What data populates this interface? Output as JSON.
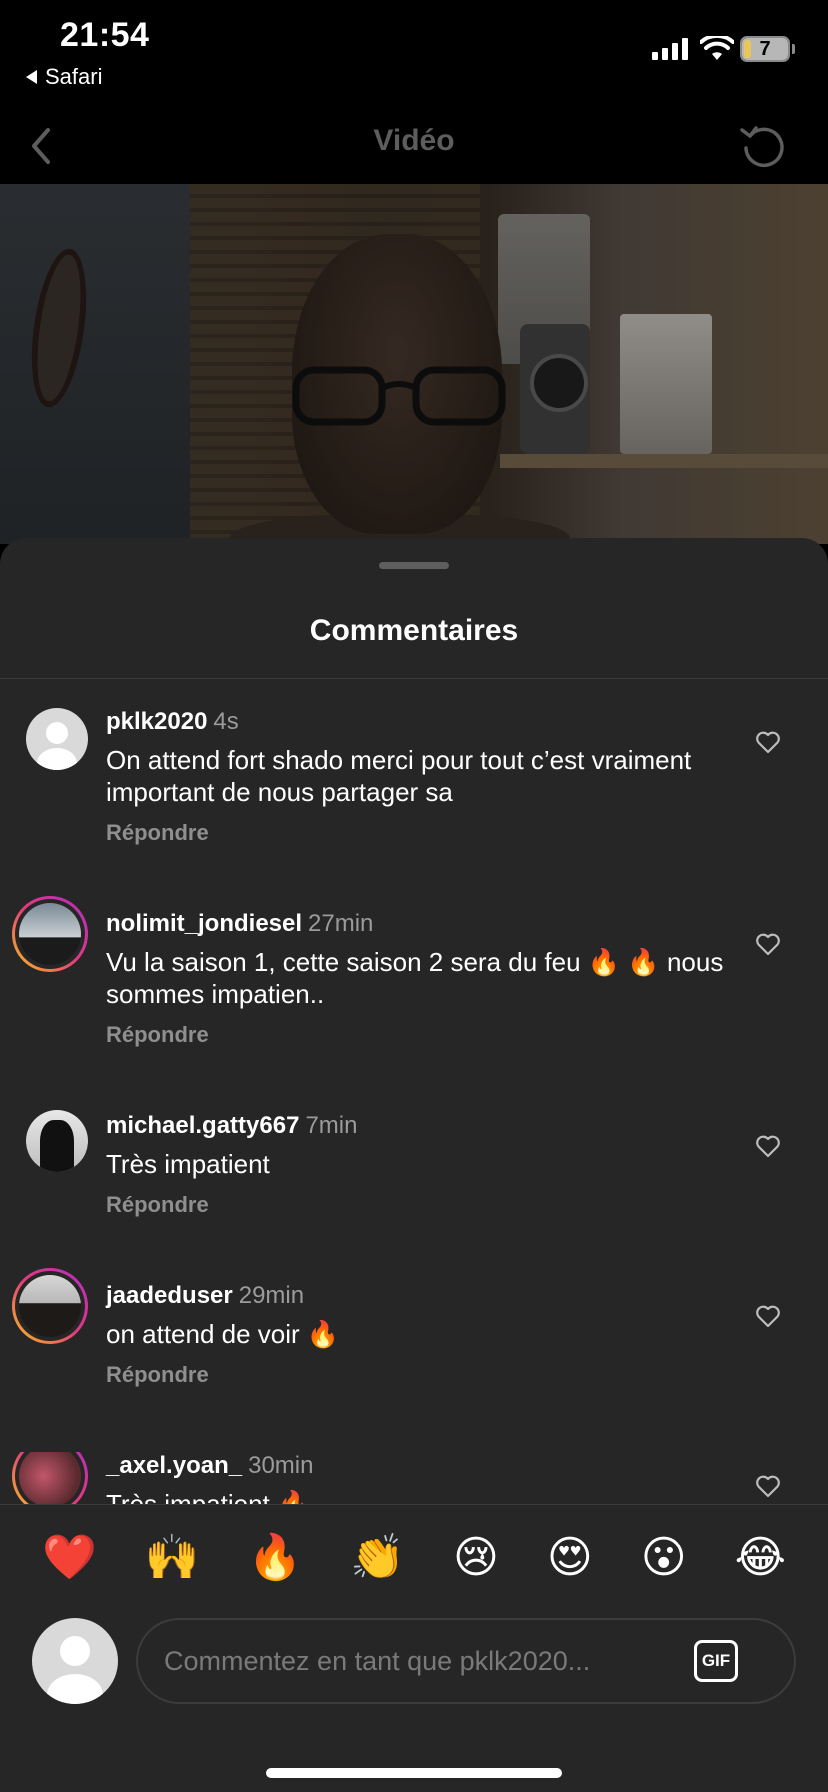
{
  "status_bar": {
    "time": "21:54",
    "back_app": "Safari",
    "battery": "7"
  },
  "navbar": {
    "title": "Vidéo"
  },
  "sheet": {
    "title": "Commentaires"
  },
  "comments": [
    {
      "username": "pklk2020",
      "ago": "4s",
      "text": "On attend fort shado merci pour tout c’est vraiment important de nous partager sa",
      "reply": "Répondre"
    },
    {
      "username": "nolimit_jondiesel",
      "ago": "27min",
      "text": "Vu la saison 1, cette saison 2 sera du feu 🔥 🔥 nous sommes impatien..",
      "reply": "Répondre"
    },
    {
      "username": "michael.gatty667",
      "ago": "7min",
      "text": "Très impatient",
      "reply": "Répondre"
    },
    {
      "username": "jaadeduser",
      "ago": "29min",
      "text": "on attend de voir 🔥",
      "reply": "Répondre"
    },
    {
      "username": "_axel.yoan_",
      "ago": "30min",
      "text": "Très impatient 🔥",
      "reply": ""
    }
  ],
  "emoji_reactions": [
    "❤️",
    "🙌",
    "🔥",
    "👏",
    "😢",
    "😍",
    "😮",
    "😂"
  ],
  "composer": {
    "placeholder": "Commentez en tant que pklk2020...",
    "gif_label": "GIF"
  }
}
